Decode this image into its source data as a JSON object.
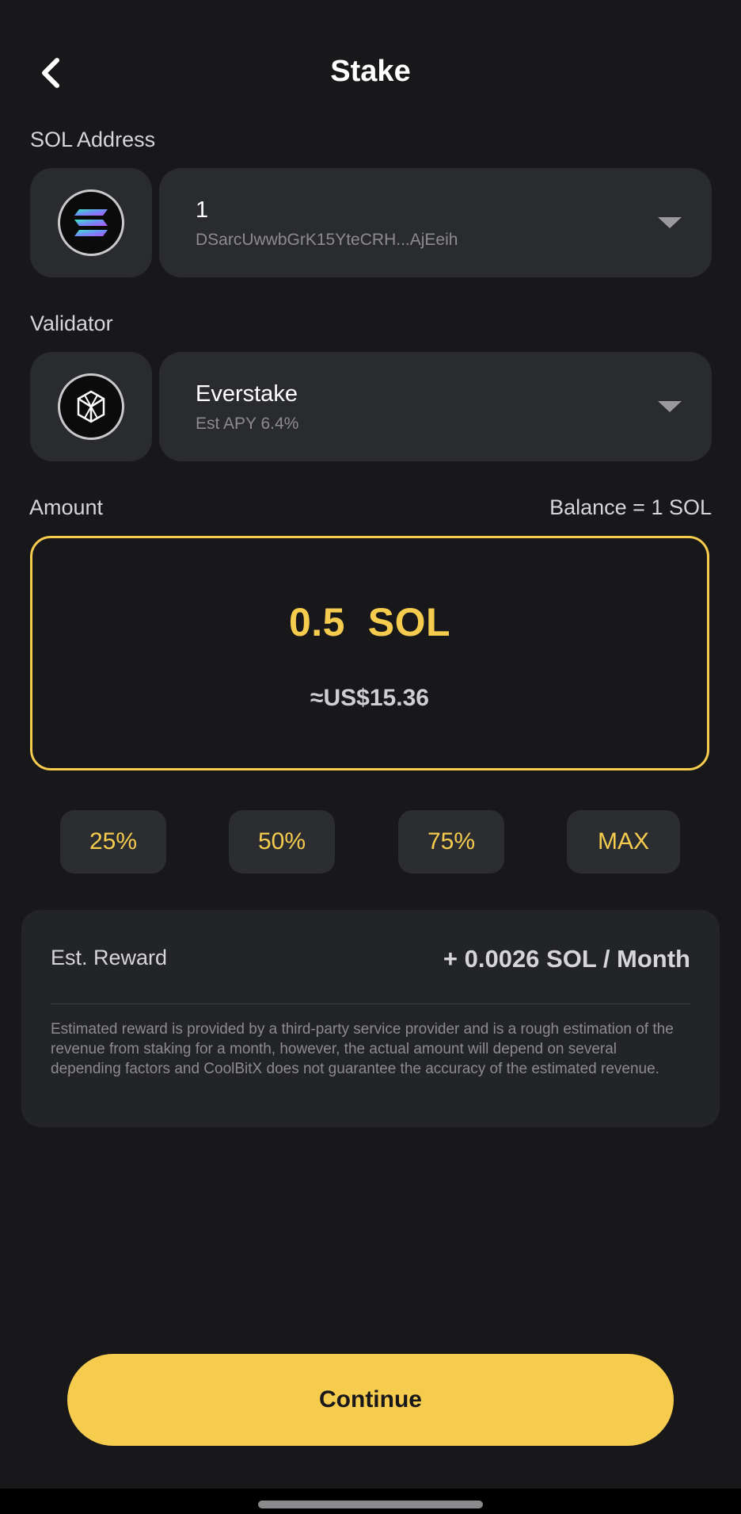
{
  "header": {
    "title": "Stake",
    "back_icon": "chevron-left-icon"
  },
  "address_section": {
    "label": "SOL Address",
    "icon": "solana-logo-icon",
    "account_name": "1",
    "address": "DSarcUwwbGrK15YteCRH...AjEeih"
  },
  "validator_section": {
    "label": "Validator",
    "icon": "everstake-logo-icon",
    "name": "Everstake",
    "apy": "Est APY 6.4%"
  },
  "amount_section": {
    "label": "Amount",
    "balance": "Balance = 1 SOL",
    "value": "0.5  SOL",
    "fiat": "≈US$15.36"
  },
  "percent_buttons": [
    {
      "label": "25%"
    },
    {
      "label": "50%"
    },
    {
      "label": "75%"
    },
    {
      "label": "MAX"
    }
  ],
  "reward": {
    "label": "Est. Reward",
    "value": "+ 0.0026 SOL / Month",
    "note": "Estimated reward is provided by a third-party service provider and is a rough estimation of the revenue from staking for a month, however, the actual amount will depend on several depending factors and CoolBitX does not guarantee the accuracy of the estimated revenue."
  },
  "footer": {
    "continue_label": "Continue"
  },
  "colors": {
    "background": "#18181a",
    "card": "#2a2b2f",
    "accent": "#f6cc4e",
    "muted_text": "#8c8c90"
  }
}
